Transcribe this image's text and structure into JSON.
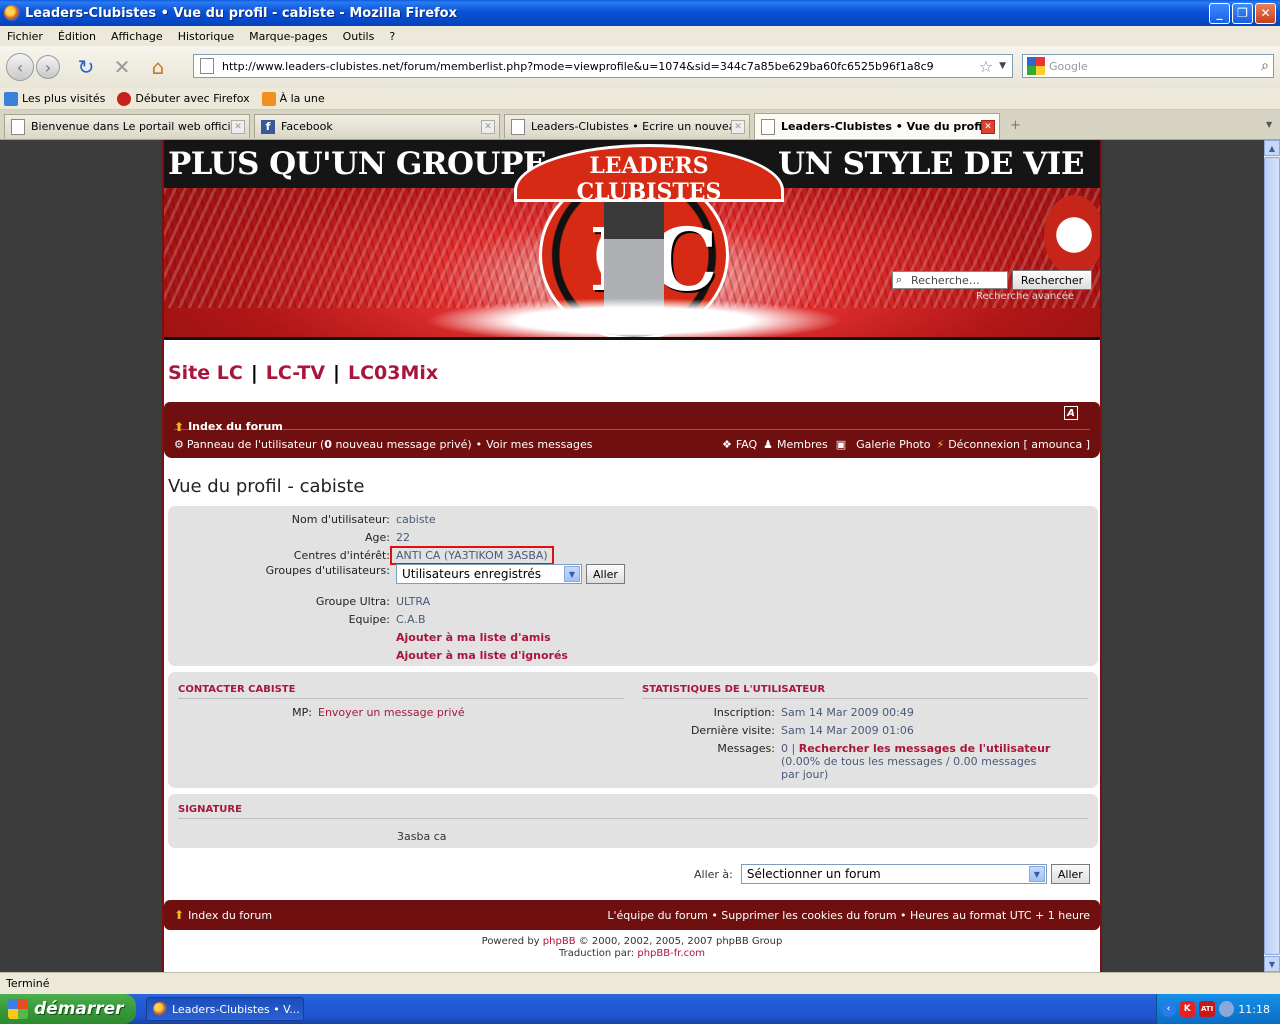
{
  "window": {
    "title": "Leaders-Clubistes • Vue du profil - cabiste - Mozilla Firefox",
    "minimize": "_",
    "maximize": "❐",
    "close": "✕"
  },
  "menubar": [
    "Fichier",
    "Édition",
    "Affichage",
    "Historique",
    "Marque-pages",
    "Outils",
    "?"
  ],
  "navbar": {
    "url": "http://www.leaders-clubistes.net/forum/memberlist.php?mode=viewprofile&u=1074&sid=344c7a85be629ba60fc6525b96f1a8c9",
    "search_placeholder": "Google"
  },
  "bookmarks": [
    "Les plus visités",
    "Débuter avec Firefox",
    "À la une"
  ],
  "tabs": [
    {
      "label": "Bienvenue dans Le portail web officiel d..."
    },
    {
      "label": "Facebook"
    },
    {
      "label": "Leaders-Clubistes • Ecrire un nouveau ..."
    },
    {
      "label": "Leaders-Clubistes • Vue du profil ..."
    }
  ],
  "banner": {
    "slogan_left": "PLUS QU'UN GROUPE",
    "slogan_right": "UN STYLE DE VIE",
    "ribbon": "LEADERS CLUBISTES",
    "search_placeholder": "Recherche…",
    "search_button": "Rechercher",
    "advanced_search": "Recherche avancée"
  },
  "site_links": [
    "Site LC",
    "LC-TV",
    "LC03Mix"
  ],
  "nav": {
    "index": "Index du forum",
    "az": "A",
    "ucp_before": "Panneau de l'utilisateur (",
    "ucp_count": "0",
    "ucp_after": " nouveau message privé)",
    "bullet": "•",
    "view_messages": "Voir mes messages",
    "faq": "FAQ",
    "members": "Membres",
    "gallery": "Galerie Photo",
    "logout": "Déconnexion [ amounca ]"
  },
  "page_title": "Vue du profil - cabiste",
  "profile": {
    "username_label": "Nom d'utilisateur:",
    "username": "cabiste",
    "age_label": "Age:",
    "age": "22",
    "interests_label": "Centres d'intérêt:",
    "interests": "ANTI CA (YA3TIKOM 3ASBA)",
    "groups_label": "Groupes d'utilisateurs:",
    "groups_selected": "Utilisateurs enregistrés",
    "go_button": "Aller",
    "ultra_label": "Groupe Ultra:",
    "ultra": "ULTRA",
    "team_label": "Equipe:",
    "team": "C.A.B",
    "add_friend": "Ajouter à ma liste d'amis",
    "add_foe": "Ajouter à ma liste d'ignorés"
  },
  "contact": {
    "heading": "CONTACTER CABISTE",
    "pm_label": "MP:",
    "pm_link": "Envoyer un message privé"
  },
  "stats": {
    "heading": "STATISTIQUES DE L'UTILISATEUR",
    "joined_label": "Inscription:",
    "joined": "Sam 14 Mar 2009 00:49",
    "last_visit_label": "Dernière visite:",
    "last_visit": "Sam 14 Mar 2009 01:06",
    "posts_label": "Messages:",
    "posts_count": "0",
    "posts_sep": "|",
    "search_posts": "Rechercher les messages de l'utilisateur",
    "posts_pct_line1": "(0.00% de tous les messages / 0.00 messages",
    "posts_pct_line2": "par jour)"
  },
  "signature": {
    "heading": "SIGNATURE",
    "text": "3asba ca"
  },
  "jump": {
    "label": "Aller à:",
    "selected": "Sélectionner un forum",
    "button": "Aller"
  },
  "footer": {
    "index": "Index du forum",
    "links": "L'équipe du forum • Supprimer les cookies du forum • Heures au format UTC + 1 heure",
    "powered_prefix": "Powered by",
    "phpbb": "phpBB",
    "copyright": "© 2000, 2002, 2005, 2007 phpBB Group",
    "translation_prefix": "Traduction par:",
    "translation_link": "phpBB-fr.com"
  },
  "status": "Terminé",
  "taskbar": {
    "start": "démarrer",
    "task": "Leaders-Clubistes • V...",
    "tray_k": "K",
    "tray_ati": "ATI",
    "clock": "11:18"
  }
}
